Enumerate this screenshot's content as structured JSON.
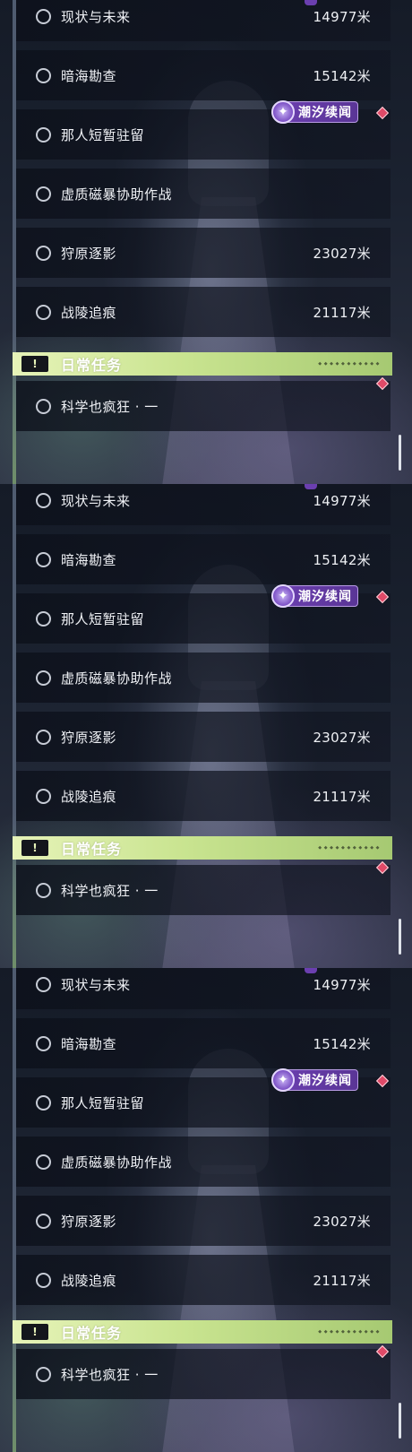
{
  "panels": [
    {
      "quests": [
        {
          "name": "现状与未来",
          "distance": "14977米"
        },
        {
          "name": "暗海勘查",
          "distance": "15142米"
        },
        {
          "name": "那人短暂驻留",
          "distance": ""
        },
        {
          "name": "虚质磁暴协助作战",
          "distance": ""
        },
        {
          "name": "狩原逐影",
          "distance": "23027米"
        },
        {
          "name": "战陵追痕",
          "distance": "21117米"
        }
      ],
      "badge": {
        "label": "潮汐续闻",
        "icon": "sparkle-icon"
      },
      "daily": {
        "title": "日常任务",
        "deco": "◆ ◆ ◆ ◆ ◆ ◆ ◆ ◆ ◆ ◆ ◆",
        "icon": "exclamation-icon",
        "quest": "科学也疯狂 · 一"
      }
    },
    {
      "quests": [
        {
          "name": "现状与未来",
          "distance": "14977米"
        },
        {
          "name": "暗海勘查",
          "distance": "15142米"
        },
        {
          "name": "那人短暂驻留",
          "distance": ""
        },
        {
          "name": "虚质磁暴协助作战",
          "distance": ""
        },
        {
          "name": "狩原逐影",
          "distance": "23027米"
        },
        {
          "name": "战陵追痕",
          "distance": "21117米"
        }
      ],
      "badge": {
        "label": "潮汐续闻",
        "icon": "sparkle-icon"
      },
      "daily": {
        "title": "日常任务",
        "deco": "◆ ◆ ◆ ◆ ◆ ◆ ◆ ◆ ◆ ◆ ◆",
        "icon": "exclamation-icon",
        "quest": "科学也疯狂 · 一"
      }
    },
    {
      "quests": [
        {
          "name": "现状与未来",
          "distance": "14977米"
        },
        {
          "name": "暗海勘查",
          "distance": "15142米"
        },
        {
          "name": "那人短暂驻留",
          "distance": ""
        },
        {
          "name": "虚质磁暴协助作战",
          "distance": ""
        },
        {
          "name": "狩原逐影",
          "distance": "23027米"
        },
        {
          "name": "战陵追痕",
          "distance": "21117米"
        }
      ],
      "badge": {
        "label": "潮汐续闻",
        "icon": "sparkle-icon"
      },
      "daily": {
        "title": "日常任务",
        "deco": "◆ ◆ ◆ ◆ ◆ ◆ ◆ ◆ ◆ ◆ ◆",
        "icon": "exclamation-icon",
        "quest": "科学也疯狂 · 一"
      }
    }
  ],
  "colors": {
    "badge": "#6b3fb0",
    "diamond": "#e04a68",
    "daily_header": "#c9e490"
  }
}
